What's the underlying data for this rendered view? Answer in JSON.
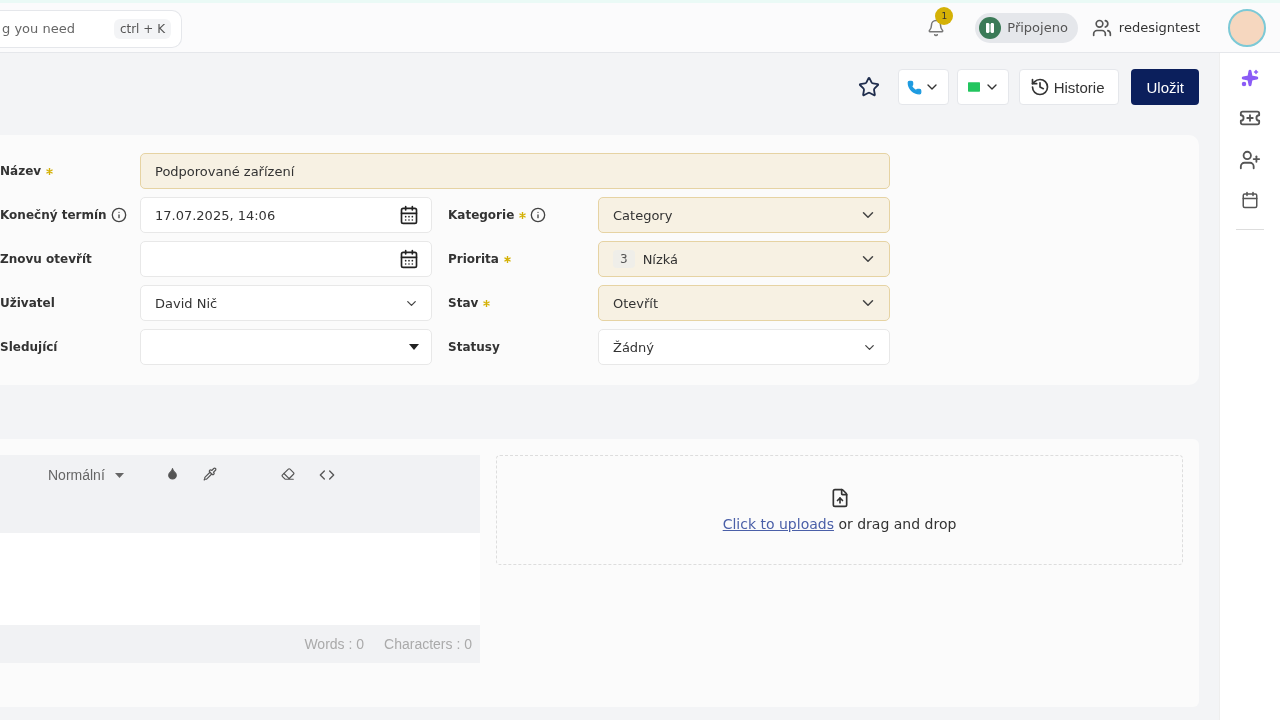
{
  "header": {
    "search": {
      "placeholder": "g you need",
      "shortcut": "ctrl + K"
    },
    "notifications": {
      "count": "1"
    },
    "connection": {
      "label": "Připojeno",
      "paused": true
    },
    "user": {
      "name": "redesigntest"
    }
  },
  "actions": {
    "favorite": false,
    "history": "Historie",
    "save": "Uložit"
  },
  "form": {
    "left": [
      {
        "label": "Název",
        "required": true,
        "info": false,
        "kind": "text",
        "value": "Podporované zařízení",
        "highlighted": true,
        "wide": true
      },
      {
        "label": "Konečný termín",
        "required": false,
        "info": true,
        "kind": "date",
        "value": "17.07.2025, 14:06",
        "highlighted": false
      },
      {
        "label": "Znovu otevřít",
        "required": false,
        "info": false,
        "kind": "date",
        "highlighted": false
      },
      {
        "label": "Uživatel",
        "required": false,
        "info": false,
        "kind": "select",
        "value": "David Nič",
        "highlighted": false
      },
      {
        "label": "Sledující",
        "required": false,
        "info": false,
        "kind": "multiselect",
        "highlighted": false
      }
    ],
    "right": [
      {
        "label": "Kategorie",
        "required": true,
        "info": true,
        "kind": "select",
        "value": "Category",
        "highlighted": true
      },
      {
        "label": "Priorita",
        "required": true,
        "info": false,
        "kind": "priority",
        "badge": "3",
        "value": "Nízká",
        "highlighted": true
      },
      {
        "label": "Stav",
        "required": true,
        "info": false,
        "kind": "select",
        "value": "Otevřít",
        "highlighted": true
      },
      {
        "label": "Statusy",
        "required": false,
        "info": false,
        "kind": "select",
        "value": "Žádný",
        "highlighted": false
      }
    ]
  },
  "editor": {
    "format": "Normální",
    "words": "Words : 0",
    "characters": "Characters : 0"
  },
  "upload": {
    "link": "Click to uploads",
    "text": "or drag and drop"
  }
}
